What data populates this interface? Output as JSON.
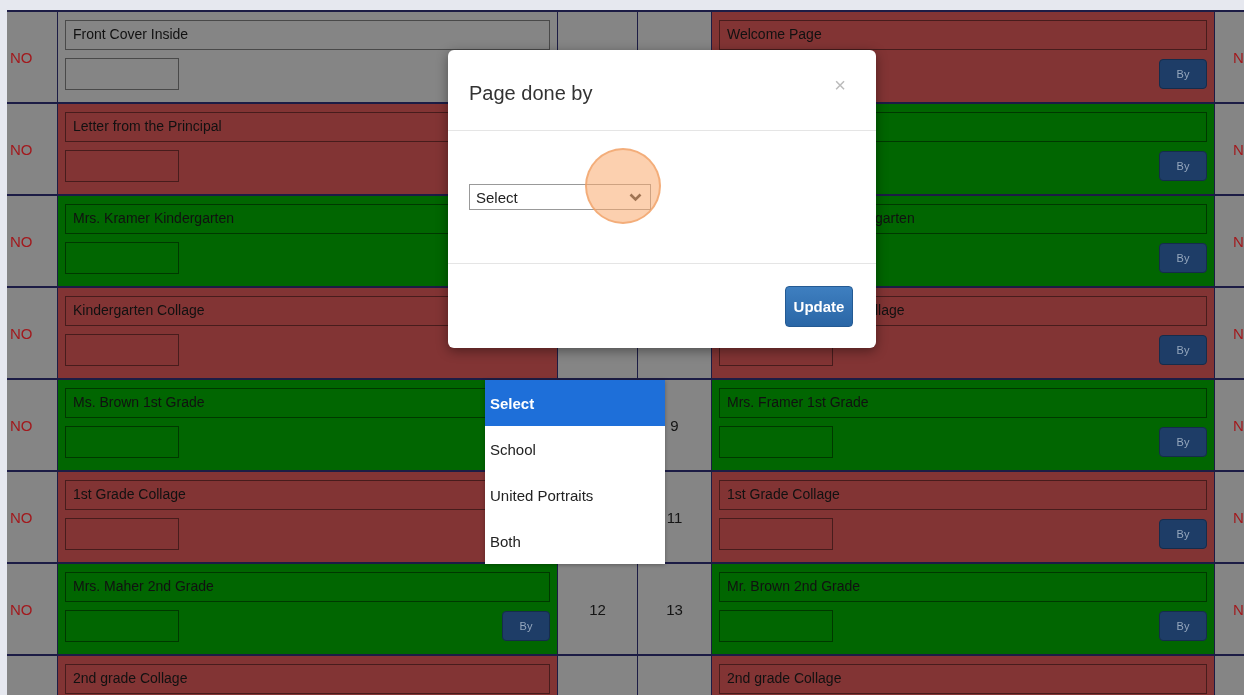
{
  "rows": [
    {
      "left_flag": "NO",
      "left_page": {
        "title": "Front Cover Inside",
        "color": "#858585"
      },
      "right_page": {
        "title": "Welcome Page",
        "color": "#823434",
        "button": "By"
      },
      "right_flag": "N"
    },
    {
      "left_flag": "NO",
      "left_page": {
        "title": "Letter from the Principal",
        "color": "#823434"
      },
      "right_page": {
        "color": "#016601",
        "button": "By"
      },
      "right_flag": "N"
    },
    {
      "left_flag": "NO",
      "left_page": {
        "title": "Mrs. Kramer Kindergarten",
        "color": "#016601"
      },
      "right_page": {
        "title": "garten",
        "covered_start": true,
        "color": "#016601",
        "button": "By"
      },
      "right_flag": "N"
    },
    {
      "left_flag": "NO",
      "left_page": {
        "title": "Kindergarten Collage",
        "color": "#823434"
      },
      "right_page": {
        "title": "llage",
        "covered_start": true,
        "color": "#823434",
        "button": "By"
      },
      "right_flag": "N"
    },
    {
      "left_flag": "NO",
      "left_page": {
        "title": "Ms. Brown 1st Grade",
        "color": "#016601"
      },
      "right_number": "9",
      "right_page": {
        "title": "Mrs. Framer 1st Grade",
        "color": "#016601",
        "button": "By"
      },
      "right_flag": "N"
    },
    {
      "left_flag": "NO",
      "left_page": {
        "title": "1st Grade Collage",
        "color": "#823434"
      },
      "right_number": "11",
      "right_page": {
        "title": "1st Grade Collage",
        "color": "#823434",
        "button": "By"
      },
      "right_flag": "N"
    },
    {
      "left_flag": "NO",
      "left_page": {
        "title": "Mrs. Maher 2nd Grade",
        "color": "#016601",
        "button": "By"
      },
      "left_number": "12",
      "right_number": "13",
      "right_page": {
        "title": "Mr. Brown 2nd Grade",
        "color": "#016601",
        "button": "By"
      },
      "right_flag": "N"
    },
    {
      "left_page": {
        "title": "2nd grade Collage",
        "color": "#823434"
      },
      "right_page": {
        "title": "2nd grade Collage",
        "color": "#823434"
      }
    }
  ],
  "dialog": {
    "title": "Page done by",
    "close": "×",
    "select": {
      "value": "Select"
    },
    "button": "Update"
  },
  "dropdown": {
    "options": [
      {
        "label": "Select",
        "selected": true
      },
      {
        "label": "School",
        "selected": false
      },
      {
        "label": "United Portraits",
        "selected": false
      },
      {
        "label": "Both",
        "selected": false
      }
    ]
  }
}
